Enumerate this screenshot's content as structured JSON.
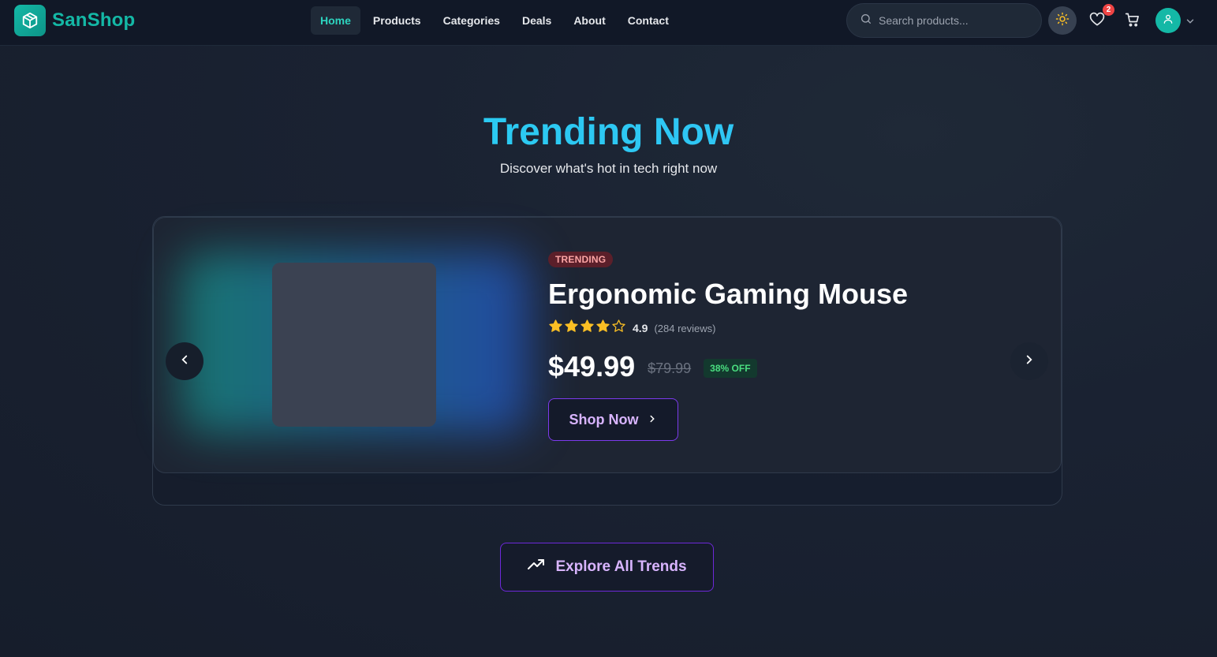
{
  "brand": {
    "name": "SanShop",
    "logo_icon": "box-icon",
    "accent": "#14b8a6"
  },
  "nav": {
    "items": [
      {
        "label": "Home",
        "active": true
      },
      {
        "label": "Products",
        "active": false
      },
      {
        "label": "Categories",
        "active": false
      },
      {
        "label": "Deals",
        "active": false
      },
      {
        "label": "About",
        "active": false
      },
      {
        "label": "Contact",
        "active": false
      }
    ]
  },
  "search": {
    "placeholder": "Search products...",
    "value": ""
  },
  "header_actions": {
    "theme_icon": "sun-icon",
    "wishlist_icon": "heart-icon",
    "wishlist_count": "2",
    "cart_icon": "cart-icon",
    "avatar_icon": "user-icon"
  },
  "hero": {
    "title": "Trending Now",
    "subtitle": "Discover what's hot in tech right now"
  },
  "slide": {
    "tag": "TRENDING",
    "product_name": "Ergonomic Gaming Mouse",
    "rating": 4.9,
    "rating_text": "4.9",
    "reviews_text": "(284 reviews)",
    "stars_filled": 4,
    "stars_total": 5,
    "price": "$49.99",
    "old_price": "$79.99",
    "discount": "38% OFF",
    "cta": "Shop Now"
  },
  "explore": {
    "label": "Explore All Trends",
    "icon": "trending-up-icon"
  },
  "colors": {
    "background": "#1a2232",
    "title": "#38bdf8",
    "star": "#fbbf24",
    "discount": "#4ade80",
    "button_border": "#7c3aed",
    "button_text": "#d8b4fe"
  }
}
